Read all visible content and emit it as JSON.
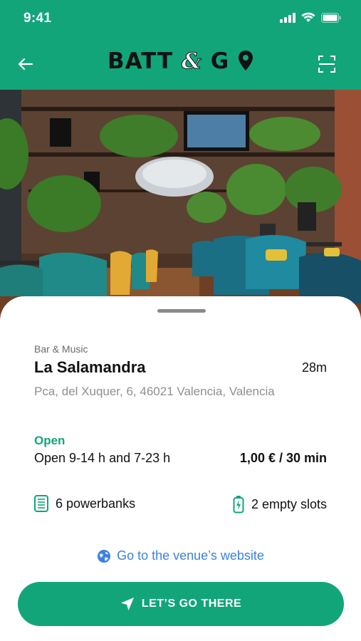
{
  "status_bar": {
    "time": "9:41"
  },
  "header": {
    "logo_text_left": "BATT",
    "logo_amp": "&",
    "logo_text_right": "G"
  },
  "venue": {
    "category": "Bar & Music",
    "name": "La Salamandra",
    "distance": "28m",
    "address": "Pca, del Xuquer, 6, 46021 Valencia, Valencia",
    "open_status": "Open",
    "hours": "Open 9-14 h and 7-23 h",
    "price": "1,00 € / 30 min",
    "powerbanks": "6 powerbanks",
    "empty_slots": "2 empty slots",
    "website_label": "Go to the venue’s website"
  },
  "cta": {
    "label": "LET’S GO THERE"
  },
  "colors": {
    "brand": "#12a57a",
    "link": "#3b82e0"
  },
  "icons": [
    "back-arrow-icon",
    "scan-icon",
    "powerbank-icon",
    "battery-icon",
    "globe-icon",
    "navigation-icon"
  ]
}
